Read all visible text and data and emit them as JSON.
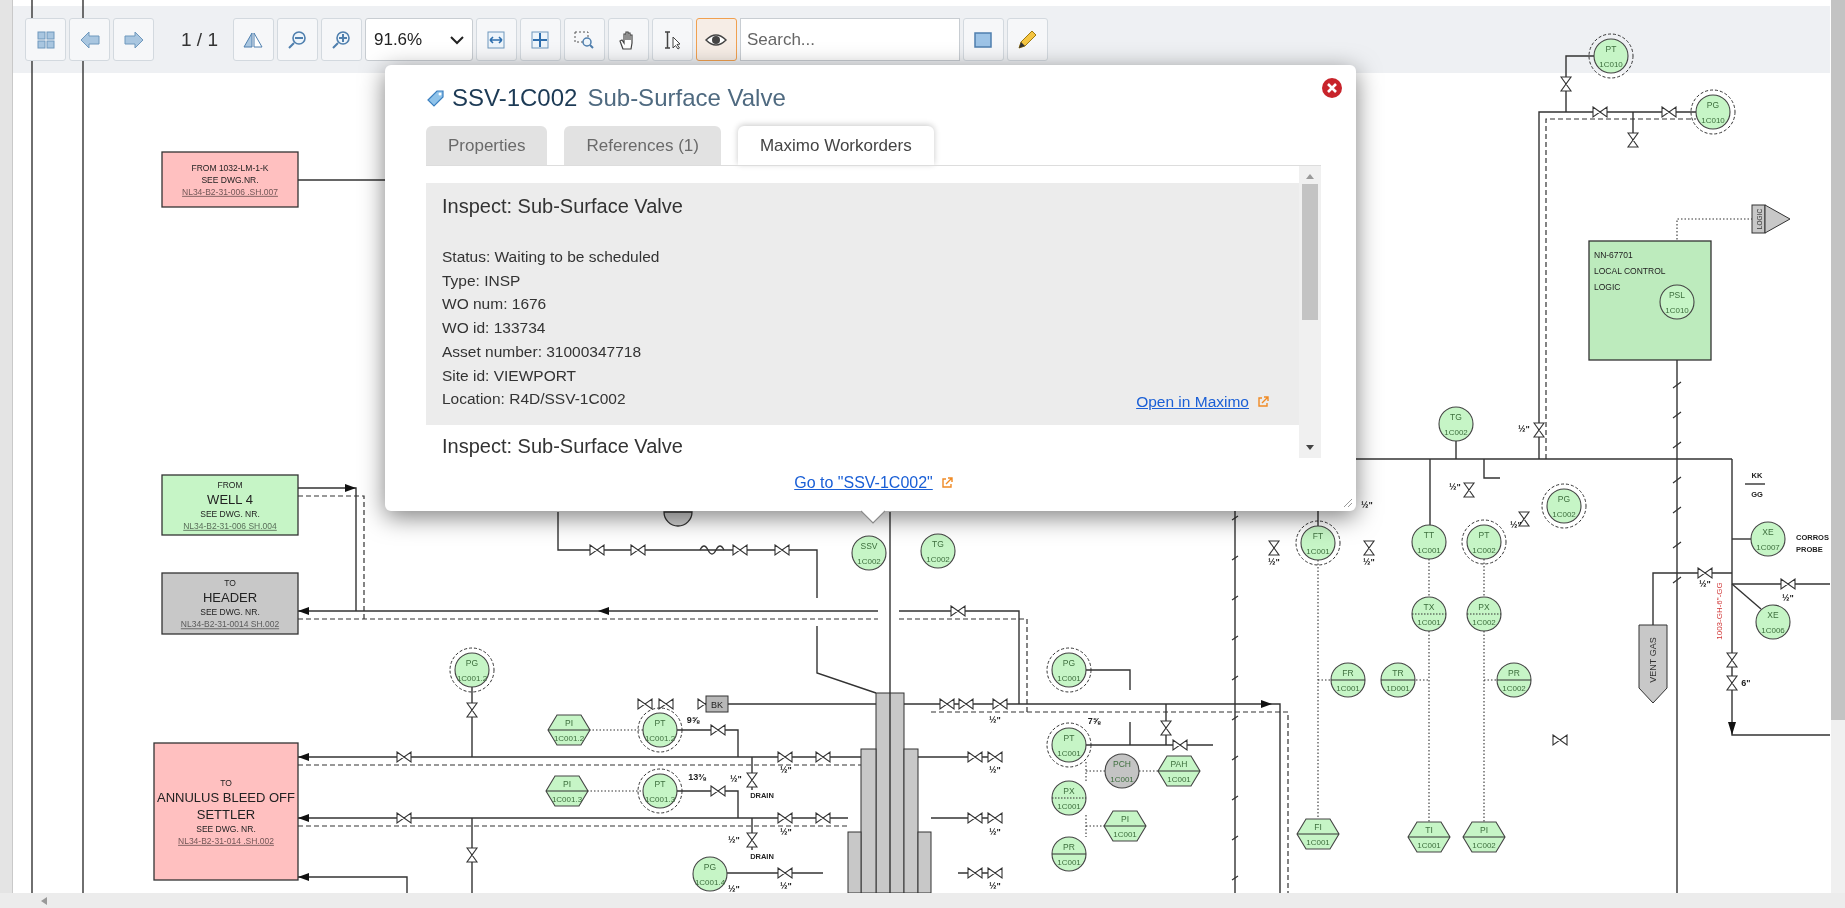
{
  "toolbar": {
    "nav_buttons": [
      {
        "selected": false
      },
      {
        "selected": false
      },
      {
        "selected": false
      }
    ],
    "page_indicator": "1 / 1",
    "view_buttons": [
      {
        "selected": false
      },
      {
        "selected": false
      },
      {
        "selected": false
      }
    ],
    "zoom_select": {
      "value": "91.6%"
    },
    "mode_buttons": [
      {
        "selected": false
      },
      {
        "selected": false
      },
      {
        "selected": false
      },
      {
        "selected": false
      },
      {
        "selected": false
      },
      {
        "selected": true
      }
    ],
    "search": {
      "placeholder": "Search..."
    },
    "markup_buttons": [
      {
        "selected": false
      },
      {
        "selected": false
      }
    ]
  },
  "drawing": {
    "reference_boxes": [
      {
        "color": "#ffc0c0",
        "lines": [
          {
            "text": "FROM 1032-LM-1-K",
            "kind": "small"
          },
          {
            "text": "SEE DWG.NR.",
            "kind": "small"
          },
          {
            "text": "NL34-B2-31-006 .SH.007",
            "kind": "ref"
          }
        ]
      },
      {
        "color": "#c6f5c6",
        "lines": [
          {
            "text": "FROM",
            "kind": "small"
          },
          {
            "text": "WELL 4",
            "kind": "large"
          },
          {
            "text": "SEE DWG. NR.",
            "kind": "small"
          },
          {
            "text": "NL34-B2-31-006 SH.004",
            "kind": "ref"
          }
        ]
      },
      {
        "color": "#c8c8c8",
        "lines": [
          {
            "text": "TO",
            "kind": "small"
          },
          {
            "text": "HEADER",
            "kind": "large"
          },
          {
            "text": "SEE DWG. NR.",
            "kind": "small"
          },
          {
            "text": "NL34-B2-31-0014 SH.002",
            "kind": "ref"
          }
        ]
      },
      {
        "color": "#ffc0c0",
        "lines": [
          {
            "text": "TO",
            "kind": "small"
          },
          {
            "text": "ANNULUS BLEED OFF",
            "kind": "large"
          },
          {
            "text": "SETTLER",
            "kind": "large"
          },
          {
            "text": "SEE DWG. NR.",
            "kind": "small"
          },
          {
            "text": "NL34-B2-31-014 .SH.002",
            "kind": "ref"
          }
        ]
      }
    ],
    "control_panel": {
      "lines": [
        "NN-67701",
        "LOCAL CONTROL",
        "LOGIC"
      ]
    },
    "instruments": [
      {
        "tag": "PT",
        "number": "1C010",
        "kind": "field",
        "dashed_ring": true,
        "color": "#c6f5c6"
      },
      {
        "tag": "PG",
        "number": "1C010",
        "kind": "field",
        "dashed_ring": true,
        "color": "#c6f5c6"
      },
      {
        "tag": "PSL",
        "number": "1C010",
        "kind": "field",
        "dashed_ring": false,
        "color": "#c6f5c6"
      },
      {
        "tag": "TG",
        "number": "1C002",
        "kind": "field",
        "dashed_ring": false,
        "color": "#c6f5c6"
      },
      {
        "tag": "PG",
        "number": "1C002",
        "kind": "field",
        "dashed_ring": true,
        "color": "#c6f5c6"
      },
      {
        "tag": "FT",
        "number": "1C001",
        "kind": "field",
        "dashed_ring": true,
        "color": "#c6f5c6"
      },
      {
        "tag": "TT",
        "number": "1C001",
        "kind": "field",
        "dashed_ring": false,
        "color": "#c6f5c6"
      },
      {
        "tag": "PT",
        "number": "1C002",
        "kind": "field",
        "dashed_ring": true,
        "color": "#c6f5c6"
      },
      {
        "tag": "XE",
        "number": "1C007",
        "kind": "field",
        "dashed_ring": false,
        "color": "#c6f5c6"
      },
      {
        "tag": "TX",
        "number": "1C001",
        "kind": "computer",
        "dashed_ring": false,
        "color": "#c6f5c6"
      },
      {
        "tag": "PX",
        "number": "1C002",
        "kind": "computer",
        "dashed_ring": false,
        "color": "#c6f5c6"
      },
      {
        "tag": "XE",
        "number": "1C006",
        "kind": "field",
        "dashed_ring": false,
        "color": "#c6f5c6"
      },
      {
        "tag": "FR",
        "number": "1C001",
        "kind": "panel",
        "dashed_ring": false,
        "color": "#c6f5c6"
      },
      {
        "tag": "TR",
        "number": "1D001",
        "kind": "panel",
        "dashed_ring": false,
        "color": "#c6f5c6"
      },
      {
        "tag": "PR",
        "number": "1C002",
        "kind": "panel",
        "dashed_ring": false,
        "color": "#c6f5c6"
      },
      {
        "tag": "FI",
        "number": "1C001",
        "kind": "hexagon",
        "dashed_ring": false,
        "color": "#c6f5c6"
      },
      {
        "tag": "TI",
        "number": "1C001",
        "kind": "hexagon",
        "dashed_ring": false,
        "color": "#c6f5c6"
      },
      {
        "tag": "PI",
        "number": "1C002",
        "kind": "hexagon",
        "dashed_ring": false,
        "color": "#c6f5c6"
      },
      {
        "tag": "SSV",
        "number": "1C002",
        "kind": "field",
        "dashed_ring": false,
        "color": "#c6f5c6"
      },
      {
        "tag": "TG",
        "number": "1C002",
        "kind": "field",
        "dashed_ring": false,
        "color": "#c6f5c6"
      },
      {
        "tag": "PG",
        "number": "1C001.2",
        "kind": "field",
        "dashed_ring": true,
        "color": "#c6f5c6"
      },
      {
        "tag": "PI",
        "number": "1C001.2",
        "kind": "hexagon",
        "dashed_ring": false,
        "color": "#c6f5c6"
      },
      {
        "tag": "PT",
        "number": "1C001.2",
        "kind": "field",
        "dashed_ring": true,
        "color": "#c6f5c6"
      },
      {
        "tag": "PI",
        "number": "1C001.3",
        "kind": "hexagon",
        "dashed_ring": false,
        "color": "#c6f5c6"
      },
      {
        "tag": "PT",
        "number": "1C001.3",
        "kind": "field",
        "dashed_ring": true,
        "color": "#c6f5c6"
      },
      {
        "tag": "PG",
        "number": "1C001.4",
        "kind": "field",
        "dashed_ring": false,
        "color": "#c6f5c6"
      },
      {
        "tag": "PG",
        "number": "1C001",
        "kind": "field",
        "dashed_ring": true,
        "color": "#c6f5c6"
      },
      {
        "tag": "PT",
        "number": "1C001",
        "kind": "field",
        "dashed_ring": true,
        "color": "#c6f5c6"
      },
      {
        "tag": "PCH",
        "number": "1C001",
        "kind": "field",
        "dashed_ring": false,
        "color": "#c4c4c4"
      },
      {
        "tag": "PAH",
        "number": "1C001",
        "kind": "hexagon",
        "dashed_ring": false,
        "color": "#c6f5c6"
      },
      {
        "tag": "PX",
        "number": "1C001",
        "kind": "computer",
        "dashed_ring": false,
        "color": "#c6f5c6"
      },
      {
        "tag": "PI",
        "number": "1C001",
        "kind": "hexagon",
        "dashed_ring": false,
        "color": "#c6f5c6"
      },
      {
        "tag": "PR",
        "number": "1C001",
        "kind": "panel",
        "dashed_ring": false,
        "color": "#c6f5c6"
      }
    ],
    "labels": [
      {
        "text": "9⅝",
        "kind": "size"
      },
      {
        "text": "13⅜",
        "kind": "size"
      },
      {
        "text": "½\"",
        "kind": "size"
      },
      {
        "text": "DRAIN",
        "kind": "note"
      },
      {
        "text": "½\"",
        "kind": "size"
      },
      {
        "text": "DRAIN",
        "kind": "note"
      },
      {
        "text": "½\"",
        "kind": "size"
      },
      {
        "text": "½\"",
        "kind": "size"
      },
      {
        "text": "½\"",
        "kind": "size"
      },
      {
        "text": "½\"",
        "kind": "size"
      },
      {
        "text": "½\"",
        "kind": "size"
      },
      {
        "text": "½\"",
        "kind": "size"
      },
      {
        "text": "½\"",
        "kind": "size"
      },
      {
        "text": "½\"",
        "kind": "size"
      },
      {
        "text": "7⅝",
        "kind": "size"
      },
      {
        "text": "½\"",
        "kind": "size"
      },
      {
        "text": "½\"",
        "kind": "size"
      },
      {
        "text": "½\"",
        "kind": "size"
      },
      {
        "text": "½\"",
        "kind": "size"
      },
      {
        "text": "½\"",
        "kind": "size"
      },
      {
        "text": "½\"",
        "kind": "size"
      },
      {
        "text": "½\"",
        "kind": "size"
      },
      {
        "text": "½\"",
        "kind": "size"
      },
      {
        "text": "6\"",
        "kind": "size"
      },
      {
        "text": "KK",
        "kind": "note"
      },
      {
        "text": "GG",
        "kind": "note"
      },
      {
        "text": "CORROS",
        "kind": "note"
      },
      {
        "text": "PROBE",
        "kind": "note"
      },
      {
        "text": "1003-GH-6\"-GG",
        "kind": "line_tag"
      },
      {
        "text": "BK",
        "kind": "block"
      },
      {
        "text": "VENT GAS",
        "kind": "vent"
      },
      {
        "text": "LOGIC",
        "kind": "offpage"
      }
    ]
  },
  "popup": {
    "tag": "SSV-1C002",
    "title": "Sub-Surface Valve",
    "tabs": [
      {
        "label": "Properties",
        "selected": false
      },
      {
        "label": "References (1)",
        "selected": false
      },
      {
        "label": "Maximo Workorders",
        "selected": true
      }
    ],
    "workorders": [
      {
        "title": "Inspect: Sub-Surface Valve",
        "expanded": true,
        "fields": [
          "Status: Waiting to be scheduled",
          "Type: INSP",
          "WO num: 1676",
          "WO id: 133734",
          "Asset number: 31000347718",
          "Site id: VIEWPORT",
          "Location: R4D/SSV-1C002"
        ],
        "link": "Open in Maximo"
      },
      {
        "title": "Inspect: Sub-Surface Valve",
        "expanded": false
      }
    ],
    "footer_link": "Go to \"SSV-1C002\""
  }
}
